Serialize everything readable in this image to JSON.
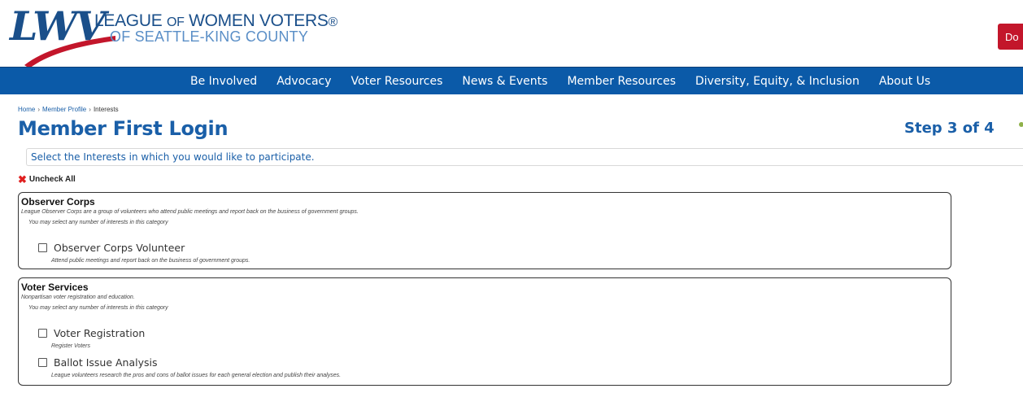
{
  "header": {
    "logo_mark": "LWV",
    "logo_line1_a": "LEAGUE",
    "logo_line1_b": "OF",
    "logo_line1_c": "WOMEN VOTERS",
    "logo_reg": "®",
    "logo_line2": "OF SEATTLE-KING COUNTY",
    "donate_label": "Do",
    "brand_blue": "#1a4f8a",
    "brand_red": "#c3162b"
  },
  "nav": {
    "color": "#0b5aa8",
    "items": [
      {
        "label": "Be Involved"
      },
      {
        "label": "Advocacy"
      },
      {
        "label": "Voter Resources"
      },
      {
        "label": "News & Events"
      },
      {
        "label": "Member Resources"
      },
      {
        "label": "Diversity, Equity, & Inclusion"
      },
      {
        "label": "About Us"
      }
    ]
  },
  "breadcrumb": {
    "items": [
      "Home",
      "Member Profile",
      "Interests"
    ],
    "separator": "›"
  },
  "page": {
    "title": "Member First Login",
    "step": "Step 3 of 4",
    "instructions": "Select the Interests in which you would like to participate.",
    "uncheck_all": "Uncheck All"
  },
  "categories": [
    {
      "title": "Observer Corps",
      "description": "League Observer Corps are a group of volunteers who attend public meetings and report back on the business of government groups.",
      "note": "You may select any number of interests in this category",
      "interests": [
        {
          "label": "Observer Corps Volunteer",
          "checked": false,
          "description": "Attend public meetings and report back on the business of government groups."
        }
      ]
    },
    {
      "title": "Voter Services",
      "description": "Nonpartisan voter registration and education.",
      "note": "You may select any number of interests in this category",
      "interests": [
        {
          "label": "Voter Registration",
          "checked": false,
          "description": "Register Voters"
        },
        {
          "label": "Ballot Issue Analysis",
          "checked": false,
          "description": "League volunteers research the pros and cons of ballot issues for each general election and publish their analyses."
        }
      ]
    }
  ]
}
